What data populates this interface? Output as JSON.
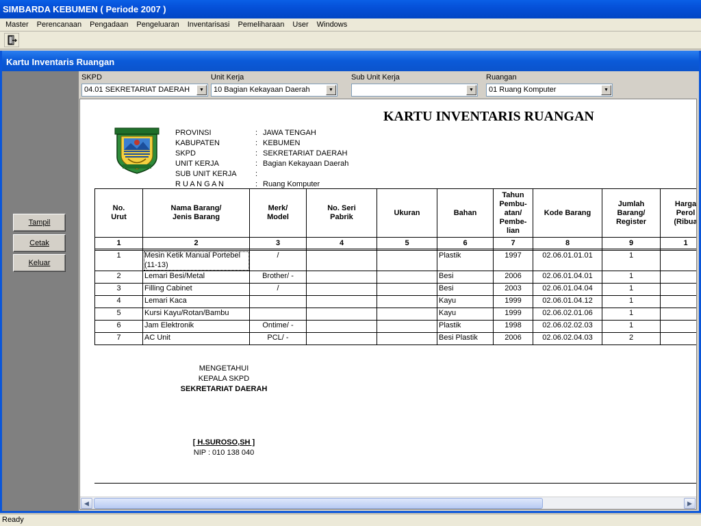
{
  "app": {
    "title": "SIMBARDA KEBUMEN ( Periode 2007 )"
  },
  "menu": [
    "Master",
    "Perencanaan",
    "Pengadaan",
    "Pengeluaran",
    "Inventarisasi",
    "Pemeliharaan",
    "User",
    "Windows"
  ],
  "toolbar": {
    "exit_icon": "door-exit-icon"
  },
  "window": {
    "title": "Kartu Inventaris Ruangan"
  },
  "side_buttons": {
    "tampil": "Tampil",
    "cetak": "Cetak",
    "keluar": "Keluar"
  },
  "filters": {
    "skpd": {
      "label": "SKPD",
      "value": "04.01 SEKRETARIAT DAERAH"
    },
    "unit_kerja": {
      "label": "Unit Kerja",
      "value": "10 Bagian Kekayaan Daerah"
    },
    "sub_unit_kerja": {
      "label": "Sub Unit Kerja",
      "value": ""
    },
    "ruangan": {
      "label": "Ruangan",
      "value": "01 Ruang Komputer"
    }
  },
  "report": {
    "title": "KARTU INVENTARIS RUANGAN",
    "info": [
      {
        "label": "PROVINSI",
        "value": "JAWA TENGAH"
      },
      {
        "label": "KABUPATEN",
        "value": "KEBUMEN"
      },
      {
        "label": "SKPD",
        "value": "SEKRETARIAT DAERAH"
      },
      {
        "label": "UNIT KERJA",
        "value": "Bagian Kekayaan Daerah"
      },
      {
        "label": "SUB UNIT KERJA",
        "value": ""
      },
      {
        "label": "R U A N G A N",
        "value": "Ruang Komputer"
      }
    ],
    "signature": {
      "line1": "MENGETAHUI",
      "line2": "KEPALA SKPD",
      "line3": "SEKRETARIAT DAERAH",
      "name": "[ H.SUROSO,SH ]",
      "nip": "NIP : 010 138 040"
    }
  },
  "chart_data": {
    "type": "table",
    "columns": [
      "No.\nUrut",
      "Nama Barang/\nJenis Barang",
      "Merk/\nModel",
      "No. Seri\nPabrik",
      "Ukuran",
      "Bahan",
      "Tahun\nPembu-\natan/\nPembe-\nlian",
      "Kode Barang",
      "Jumlah\nBarang/\nRegister",
      "Harga\nPerol\n(Ribua"
    ],
    "column_numbers": [
      "1",
      "2",
      "3",
      "4",
      "5",
      "6",
      "7",
      "8",
      "9",
      "1"
    ],
    "rows": [
      [
        "1",
        "Mesin Ketik Manual Portebel (11-13)",
        "/",
        "",
        "",
        "Plastik",
        "1997",
        "02.06.01.01.01",
        "1",
        ""
      ],
      [
        "2",
        "Lemari Besi/Metal",
        "Brother/ -",
        "",
        "",
        "Besi",
        "2006",
        "02.06.01.04.01",
        "1",
        ""
      ],
      [
        "3",
        "Filling Cabinet",
        "/",
        "",
        "",
        "Besi",
        "2003",
        "02.06.01.04.04",
        "1",
        ""
      ],
      [
        "4",
        "Lemari Kaca",
        "",
        "",
        "",
        "Kayu",
        "1999",
        "02.06.01.04.12",
        "1",
        ""
      ],
      [
        "5",
        "Kursi Kayu/Rotan/Bambu",
        "",
        "",
        "",
        "Kayu",
        "1999",
        "02.06.02.01.06",
        "1",
        ""
      ],
      [
        "6",
        "Jam Elektronik",
        "Ontime/ -",
        "",
        "",
        "Plastik",
        "1998",
        "02.06.02.02.03",
        "1",
        ""
      ],
      [
        "7",
        "AC  Unit",
        "PCL/ -",
        "",
        "",
        "Besi Plastik",
        "2006",
        "02.06.02.04.03",
        "2",
        ""
      ]
    ]
  },
  "status": {
    "text": "Ready"
  }
}
